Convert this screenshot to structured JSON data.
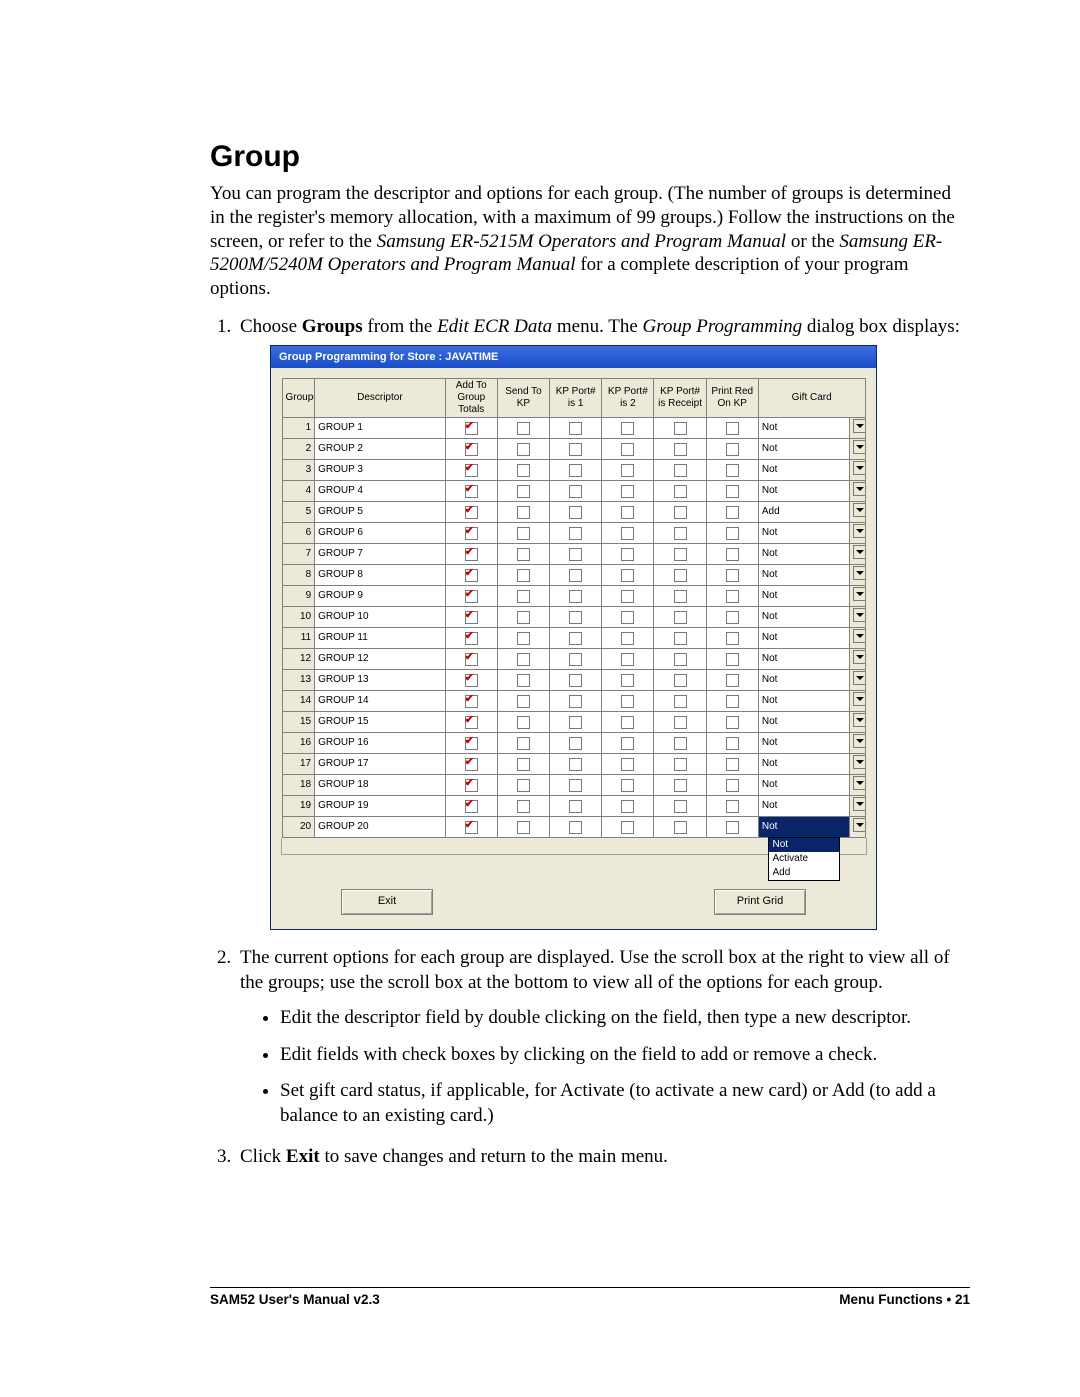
{
  "heading": "Group",
  "intro_parts": {
    "a": "You can program the descriptor and options for each group.  (The number of groups is determined in the register's memory allocation, with a maximum of 99 groups.)  Follow the instructions on the screen, or refer to the ",
    "i1": "Samsung ER-5215M Operators and Program Manual",
    "b": " or the ",
    "i2": "Samsung ER-5200M/5240M Operators and Program Manual",
    "c": " for a complete description of your program options."
  },
  "step1": {
    "a": "Choose ",
    "b1": "Groups",
    "b": " from the ",
    "i1": "Edit ECR Data",
    "c": " menu.  The ",
    "i2": "Group Programming",
    "d": " dialog box displays:"
  },
  "dialog": {
    "title": "Group Programming for Store :  JAVATIME",
    "columns": [
      "Group#",
      "Descriptor",
      "Add To Group Totals",
      "Send To KP",
      "KP Port# is 1",
      "KP Port# is 2",
      "KP Port# is Receipt",
      "Print Red On KP",
      "Gift Card"
    ],
    "rows": [
      {
        "n": 1,
        "d": "GROUP 1",
        "g": "Not"
      },
      {
        "n": 2,
        "d": "GROUP 2",
        "g": "Not"
      },
      {
        "n": 3,
        "d": "GROUP 3",
        "g": "Not"
      },
      {
        "n": 4,
        "d": "GROUP 4",
        "g": "Not"
      },
      {
        "n": 5,
        "d": "GROUP 5",
        "g": "Add"
      },
      {
        "n": 6,
        "d": "GROUP 6",
        "g": "Not"
      },
      {
        "n": 7,
        "d": "GROUP 7",
        "g": "Not"
      },
      {
        "n": 8,
        "d": "GROUP 8",
        "g": "Not"
      },
      {
        "n": 9,
        "d": "GROUP 9",
        "g": "Not"
      },
      {
        "n": 10,
        "d": "GROUP 10",
        "g": "Not"
      },
      {
        "n": 11,
        "d": "GROUP 11",
        "g": "Not"
      },
      {
        "n": 12,
        "d": "GROUP 12",
        "g": "Not"
      },
      {
        "n": 13,
        "d": "GROUP 13",
        "g": "Not"
      },
      {
        "n": 14,
        "d": "GROUP 14",
        "g": "Not"
      },
      {
        "n": 15,
        "d": "GROUP 15",
        "g": "Not"
      },
      {
        "n": 16,
        "d": "GROUP 16",
        "g": "Not"
      },
      {
        "n": 17,
        "d": "GROUP 17",
        "g": "Not"
      },
      {
        "n": 18,
        "d": "GROUP 18",
        "g": "Not"
      },
      {
        "n": 19,
        "d": "GROUP 19",
        "g": "Not"
      },
      {
        "n": 20,
        "d": "GROUP 20",
        "g": "Not",
        "open": true
      }
    ],
    "dropdown_options": [
      "Not",
      "Activate",
      "Add"
    ],
    "buttons": {
      "exit": "Exit",
      "print": "Print Grid"
    }
  },
  "step2": "The current options for each group are displayed.  Use the scroll box at the right to view all of the groups; use the scroll box at the bottom to view all of the options for each group.",
  "bullets": [
    "Edit the descriptor field by double clicking on the field, then type a new descriptor.",
    "Edit fields with check boxes by clicking on the field to add or remove a check.",
    "Set gift card status, if applicable, for Activate (to activate a new card) or Add (to add a balance to an existing card.)"
  ],
  "step3": {
    "a": "Click ",
    "b": "Exit",
    "c": " to save changes and return to the main menu."
  },
  "footer": {
    "left": "SAM52 User's Manual v2.3",
    "right": "Menu Functions  •  21"
  }
}
